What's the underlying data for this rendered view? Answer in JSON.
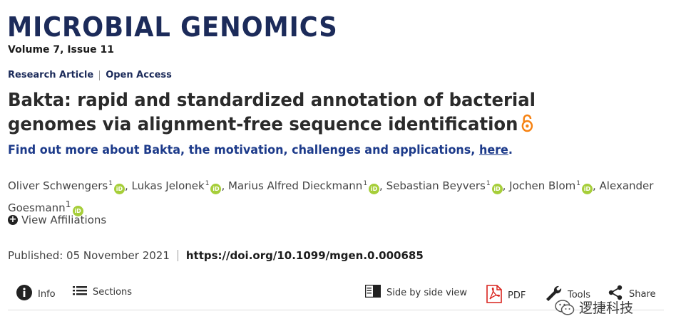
{
  "journal": {
    "title": "MICROBIAL GENOMICS",
    "volume": "Volume 7, Issue 11"
  },
  "article_meta": {
    "type": "Research Article",
    "access": "Open Access"
  },
  "article": {
    "title": "Bakta: rapid and standardized annotation of bacterial genomes via alignment-free sequence identification",
    "find_out_prefix": "Find out more about Bakta, the motivation, challenges and applications, ",
    "find_out_link": "here",
    "find_out_suffix": "."
  },
  "authors": [
    {
      "name": "Oliver Schwengers",
      "aff": "1"
    },
    {
      "name": "Lukas Jelonek",
      "aff": "1"
    },
    {
      "name": "Marius Alfred Dieckmann",
      "aff": "1"
    },
    {
      "name": "Sebastian Beyvers",
      "aff": "1"
    },
    {
      "name": "Jochen Blom",
      "aff": "1"
    },
    {
      "name": "Alexander Goesmann",
      "aff": "1"
    }
  ],
  "orcid_label": "iD",
  "view_affiliations": "View Affiliations",
  "published": "Published: 05 November 2021",
  "doi": "https://doi.org/10.1099/mgen.0.000685",
  "toolbar": {
    "info": "Info",
    "sections": "Sections",
    "side_by_side": "Side by side view",
    "pdf": "PDF",
    "tools": "Tools",
    "share": "Share"
  },
  "watermark": "逻捷科技",
  "colors": {
    "journal_navy": "#1c2b5a",
    "link_blue": "#1c3a8a",
    "orcid_green": "#a6ce39",
    "open_access_orange": "#f68212",
    "pdf_red": "#d9231d"
  },
  "icons": [
    "open-access-icon",
    "orcid-icon",
    "plus-circle-icon",
    "info-icon",
    "list-icon",
    "side-by-side-icon",
    "pdf-icon",
    "wrench-icon",
    "share-icon",
    "wechat-icon"
  ]
}
